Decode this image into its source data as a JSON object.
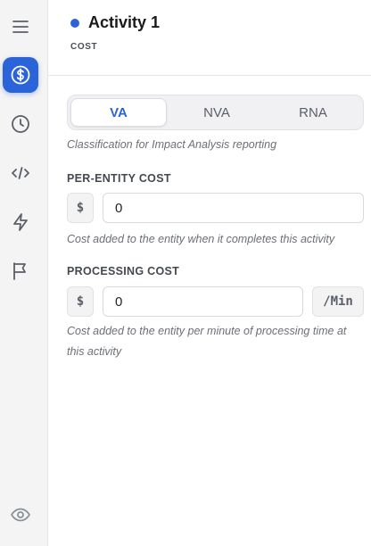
{
  "rail": {
    "icons": [
      "menu-icon",
      "dollar-icon",
      "clock-icon",
      "code-icon",
      "lightning-icon",
      "flag-icon",
      "eye-icon"
    ]
  },
  "header": {
    "title": "Activity 1",
    "subtitle": "COST",
    "status_color": "#2b63d9"
  },
  "classification": {
    "options": [
      "VA",
      "NVA",
      "RNA"
    ],
    "selected": "VA",
    "hint": "Classification for Impact Analysis reporting"
  },
  "per_entity_cost": {
    "label": "PER-ENTITY COST",
    "prefix": "$",
    "value": "0",
    "hint": "Cost added to the entity when it completes this activity"
  },
  "processing_cost": {
    "label": "PROCESSING COST",
    "prefix": "$",
    "value": "0",
    "suffix": "/Min",
    "hint": "Cost added to the entity per minute of processing time at this activity"
  },
  "colors": {
    "accent": "#2b63d9"
  }
}
